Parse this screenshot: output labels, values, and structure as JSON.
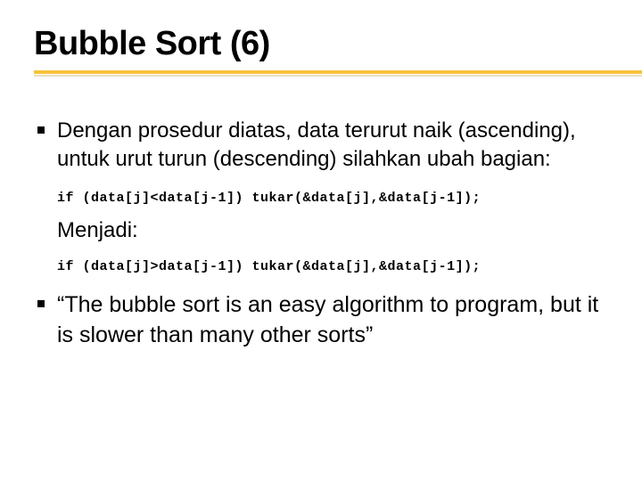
{
  "title": "Bubble Sort (6)",
  "bullet1": "Dengan prosedur diatas,  data terurut naik (ascending),  untuk  urut turun (descending) silahkan ubah bagian:",
  "code1": "if (data[j]<data[j-1]) tukar(&data[j],&data[j-1]);",
  "menjadi": "Menjadi:",
  "code2": "if (data[j]>data[j-1]) tukar(&data[j],&data[j-1]);",
  "bullet2": "“The bubble sort is an easy algorithm to program, but it is slower than many other sorts”"
}
